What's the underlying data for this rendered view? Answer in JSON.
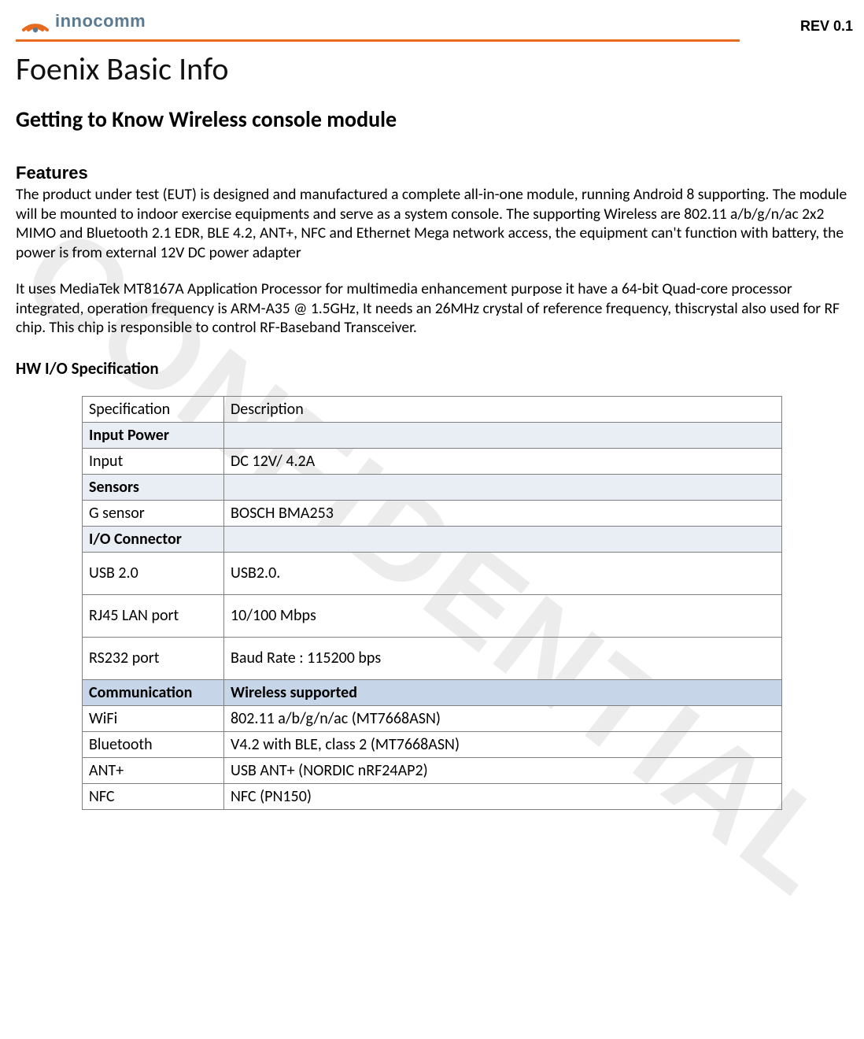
{
  "header": {
    "logo_text": "innocomm",
    "rev": "REV 0.1"
  },
  "watermark": "CONFIDENTIAL",
  "doc": {
    "title": "Foenix Basic Info",
    "subtitle": "Getting to Know Wireless console module",
    "features_heading": "Features",
    "features_p1": "The product under test (EUT) is designed and manufactured a complete all-in-one module, running Android 8 supporting. The module will be mounted to indoor exercise equipments and serve as a    system console. The supporting Wireless are 802.11 a/b/g/n/ac 2x2 MIMO and Bluetooth 2.1 EDR, BLE 4.2, ANT+, NFC and Ethernet Mega network access, the equipment can't function with battery, the power is from external 12V DC power adapter",
    "features_p2": "It uses MediaTek MT8167A Application Processor for multimedia enhancement purpose it have a 64-bit Quad-core processor integrated, operation frequency is ARM-A35 @ 1.5GHz, It needs an 26MHz crystal of reference frequency, thiscrystal also used for RF chip. This chip is responsible to control RF-Baseband Transceiver.",
    "hw_spec_heading": "HW I/O Specification"
  },
  "table": {
    "header": {
      "c0": "Specification",
      "c1": "Description"
    },
    "sections": [
      {
        "style": "hdr1",
        "c0": "Input Power",
        "c1": ""
      },
      {
        "style": "row",
        "c0": "Input",
        "c1": "DC 12V/ 4.2A"
      },
      {
        "style": "hdr1",
        "c0": "Sensors",
        "c1": ""
      },
      {
        "style": "row",
        "c0": "G sensor",
        "c1": "BOSCH BMA253"
      },
      {
        "style": "hdr1",
        "c0": "I/O Connector",
        "c1": ""
      },
      {
        "style": "tall",
        "c0": "USB 2.0",
        "c1": "USB2.0."
      },
      {
        "style": "tall",
        "c0": "RJ45 LAN port",
        "c1": "10/100 Mbps"
      },
      {
        "style": "tall",
        "c0": "RS232 port",
        "c1": "Baud Rate : 115200 bps"
      },
      {
        "style": "hdr2",
        "c0": "Communication",
        "c1": "Wireless supported"
      },
      {
        "style": "row",
        "c0": "WiFi",
        "c1": "802.11 a/b/g/n/ac (MT7668ASN)"
      },
      {
        "style": "row",
        "c0": "Bluetooth",
        "c1": "V4.2 with BLE, class 2 (MT7668ASN)"
      },
      {
        "style": "row",
        "c0": "ANT+",
        "c1": "USB ANT+ (NORDIC nRF24AP2)"
      },
      {
        "style": "row",
        "c0": "NFC",
        "c1": "NFC (PN150)"
      }
    ]
  }
}
